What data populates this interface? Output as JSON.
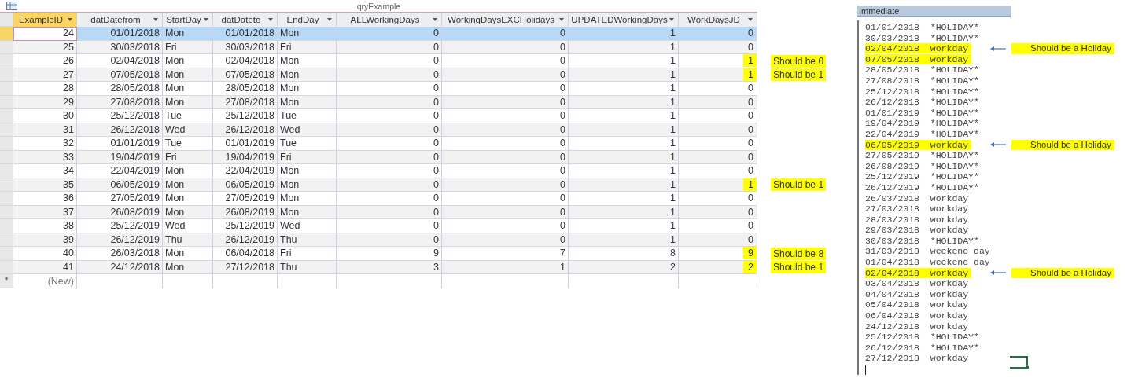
{
  "query_window": {
    "title": "qryExample",
    "columns": [
      {
        "label": "ExampleID",
        "kind": "number",
        "active": true
      },
      {
        "label": "datDatefrom",
        "kind": "number",
        "active": false
      },
      {
        "label": "StartDay",
        "kind": "text",
        "active": false
      },
      {
        "label": "datDateto",
        "kind": "number",
        "active": false
      },
      {
        "label": "EndDay",
        "kind": "text",
        "active": false
      },
      {
        "label": "ALLWorkingDays",
        "kind": "number",
        "active": false
      },
      {
        "label": "WorkingDaysEXCHolidays",
        "kind": "number",
        "active": false
      },
      {
        "label": "UPDATEDWorkingDays",
        "kind": "number",
        "active": false
      },
      {
        "label": "WorkDaysJD",
        "kind": "number",
        "active": false
      }
    ],
    "rows": [
      {
        "selected": true,
        "highlighted": false,
        "cells": [
          "24",
          "01/01/2018",
          "Mon",
          "01/01/2018",
          "Mon",
          "0",
          "0",
          "1",
          "0"
        ]
      },
      {
        "selected": false,
        "highlighted": false,
        "cells": [
          "25",
          "30/03/2018",
          "Fri",
          "30/03/2018",
          "Fri",
          "0",
          "0",
          "1",
          "0"
        ]
      },
      {
        "selected": false,
        "highlighted": true,
        "note": "Should be 0",
        "cells": [
          "26",
          "02/04/2018",
          "Mon",
          "02/04/2018",
          "Mon",
          "0",
          "0",
          "1",
          "1"
        ]
      },
      {
        "selected": false,
        "highlighted": true,
        "note": "Should be 1",
        "cells": [
          "27",
          "07/05/2018",
          "Mon",
          "07/05/2018",
          "Mon",
          "0",
          "0",
          "1",
          "1"
        ]
      },
      {
        "selected": false,
        "highlighted": false,
        "cells": [
          "28",
          "28/05/2018",
          "Mon",
          "28/05/2018",
          "Mon",
          "0",
          "0",
          "1",
          "0"
        ]
      },
      {
        "selected": false,
        "highlighted": false,
        "cells": [
          "29",
          "27/08/2018",
          "Mon",
          "27/08/2018",
          "Mon",
          "0",
          "0",
          "1",
          "0"
        ]
      },
      {
        "selected": false,
        "highlighted": false,
        "cells": [
          "30",
          "25/12/2018",
          "Tue",
          "25/12/2018",
          "Tue",
          "0",
          "0",
          "1",
          "0"
        ]
      },
      {
        "selected": false,
        "highlighted": false,
        "cells": [
          "31",
          "26/12/2018",
          "Wed",
          "26/12/2018",
          "Wed",
          "0",
          "0",
          "1",
          "0"
        ]
      },
      {
        "selected": false,
        "highlighted": false,
        "cells": [
          "32",
          "01/01/2019",
          "Tue",
          "01/01/2019",
          "Tue",
          "0",
          "0",
          "1",
          "0"
        ]
      },
      {
        "selected": false,
        "highlighted": false,
        "cells": [
          "33",
          "19/04/2019",
          "Fri",
          "19/04/2019",
          "Fri",
          "0",
          "0",
          "1",
          "0"
        ]
      },
      {
        "selected": false,
        "highlighted": false,
        "cells": [
          "34",
          "22/04/2019",
          "Mon",
          "22/04/2019",
          "Mon",
          "0",
          "0",
          "1",
          "0"
        ]
      },
      {
        "selected": false,
        "highlighted": true,
        "note": "Should be 1",
        "cells": [
          "35",
          "06/05/2019",
          "Mon",
          "06/05/2019",
          "Mon",
          "0",
          "0",
          "1",
          "1"
        ]
      },
      {
        "selected": false,
        "highlighted": false,
        "cells": [
          "36",
          "27/05/2019",
          "Mon",
          "27/05/2019",
          "Mon",
          "0",
          "0",
          "1",
          "0"
        ]
      },
      {
        "selected": false,
        "highlighted": false,
        "cells": [
          "37",
          "26/08/2019",
          "Mon",
          "26/08/2019",
          "Mon",
          "0",
          "0",
          "1",
          "0"
        ]
      },
      {
        "selected": false,
        "highlighted": false,
        "cells": [
          "38",
          "25/12/2019",
          "Wed",
          "25/12/2019",
          "Wed",
          "0",
          "0",
          "1",
          "0"
        ]
      },
      {
        "selected": false,
        "highlighted": false,
        "cells": [
          "39",
          "26/12/2019",
          "Thu",
          "26/12/2019",
          "Thu",
          "0",
          "0",
          "1",
          "0"
        ]
      },
      {
        "selected": false,
        "highlighted": true,
        "note": "Should be 8",
        "cells": [
          "40",
          "26/03/2018",
          "Mon",
          "06/04/2018",
          "Fri",
          "9",
          "7",
          "8",
          "9"
        ]
      },
      {
        "selected": false,
        "highlighted": true,
        "note": "Should be 1",
        "cells": [
          "41",
          "24/12/2018",
          "Mon",
          "27/12/2018",
          "Thu",
          "3",
          "1",
          "2",
          "2"
        ]
      }
    ],
    "new_row": {
      "marker": "*",
      "label": "(New)"
    }
  },
  "immediate": {
    "title": "Immediate",
    "lines": [
      {
        "text": "01/01/2018  *HOLIDAY*",
        "highlighted": false
      },
      {
        "text": "30/03/2018  *HOLIDAY*",
        "highlighted": false
      },
      {
        "text": "02/04/2018  workday",
        "highlighted": true,
        "note": "Should be a Holiday"
      },
      {
        "text": "07/05/2018  workday",
        "highlighted": true
      },
      {
        "text": "28/05/2018  *HOLIDAY*",
        "highlighted": false
      },
      {
        "text": "27/08/2018  *HOLIDAY*",
        "highlighted": false
      },
      {
        "text": "25/12/2018  *HOLIDAY*",
        "highlighted": false
      },
      {
        "text": "26/12/2018  *HOLIDAY*",
        "highlighted": false
      },
      {
        "text": "01/01/2019  *HOLIDAY*",
        "highlighted": false
      },
      {
        "text": "19/04/2019  *HOLIDAY*",
        "highlighted": false
      },
      {
        "text": "22/04/2019  *HOLIDAY*",
        "highlighted": false
      },
      {
        "text": "06/05/2019  workday",
        "highlighted": true,
        "note": "Should be a Holiday"
      },
      {
        "text": "27/05/2019  *HOLIDAY*",
        "highlighted": false
      },
      {
        "text": "26/08/2019  *HOLIDAY*",
        "highlighted": false
      },
      {
        "text": "25/12/2019  *HOLIDAY*",
        "highlighted": false
      },
      {
        "text": "26/12/2019  *HOLIDAY*",
        "highlighted": false
      },
      {
        "text": "26/03/2018  workday",
        "highlighted": false
      },
      {
        "text": "27/03/2018  workday",
        "highlighted": false
      },
      {
        "text": "28/03/2018  workday",
        "highlighted": false
      },
      {
        "text": "29/03/2018  workday",
        "highlighted": false
      },
      {
        "text": "30/03/2018  *HOLIDAY*",
        "highlighted": false
      },
      {
        "text": "31/03/2018  weekend day",
        "highlighted": false
      },
      {
        "text": "01/04/2018  weekend day",
        "highlighted": false
      },
      {
        "text": "02/04/2018  workday",
        "highlighted": true,
        "note": "Should be a Holiday"
      },
      {
        "text": "03/04/2018  workday",
        "highlighted": false
      },
      {
        "text": "04/04/2018  workday",
        "highlighted": false
      },
      {
        "text": "05/04/2018  workday",
        "highlighted": false
      },
      {
        "text": "06/04/2018  workday",
        "highlighted": false
      },
      {
        "text": "24/12/2018  workday",
        "highlighted": false
      },
      {
        "text": "25/12/2018  *HOLIDAY*",
        "highlighted": false
      },
      {
        "text": "26/12/2018  *HOLIDAY*",
        "highlighted": false
      },
      {
        "text": "27/12/2018  workday",
        "highlighted": false
      }
    ]
  }
}
